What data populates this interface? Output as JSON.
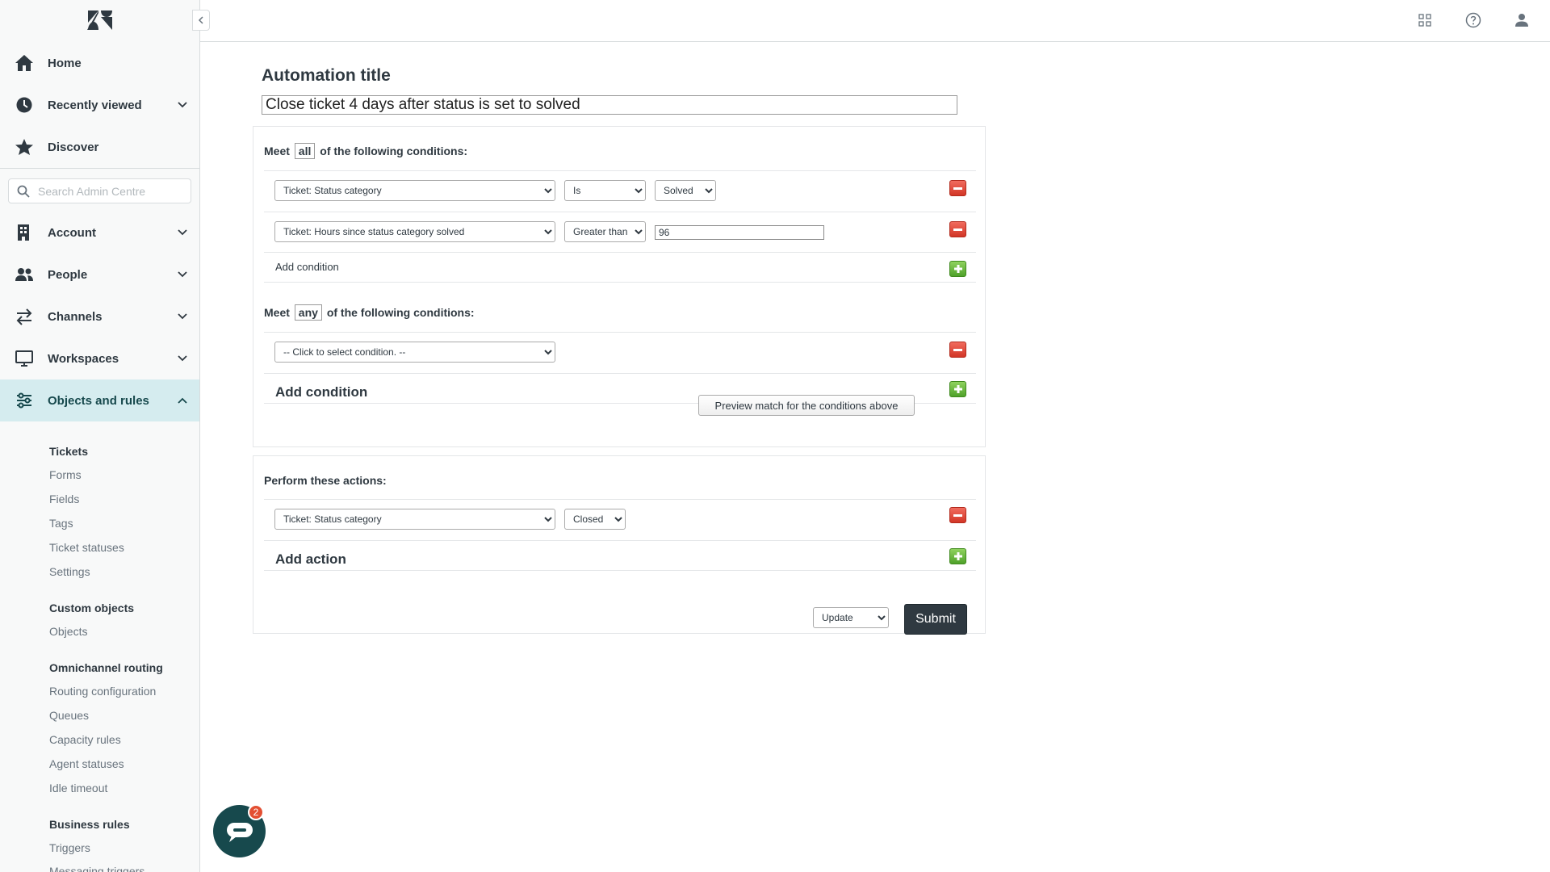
{
  "sidebar": {
    "nav_top": [
      {
        "label": "Home"
      },
      {
        "label": "Recently viewed"
      },
      {
        "label": "Discover"
      }
    ],
    "search_placeholder": "Search Admin Centre",
    "nav_main": [
      {
        "label": "Account"
      },
      {
        "label": "People"
      },
      {
        "label": "Channels"
      },
      {
        "label": "Workspaces"
      },
      {
        "label": "Objects and rules"
      }
    ],
    "sections": [
      {
        "heading": "Tickets",
        "links": [
          "Forms",
          "Fields",
          "Tags",
          "Ticket statuses",
          "Settings"
        ]
      },
      {
        "heading": "Custom objects",
        "links": [
          "Objects"
        ]
      },
      {
        "heading": "Omnichannel routing",
        "links": [
          "Routing configuration",
          "Queues",
          "Capacity rules",
          "Agent statuses",
          "Idle timeout"
        ]
      },
      {
        "heading": "Business rules",
        "links": [
          "Triggers",
          "Messaging triggers"
        ]
      }
    ]
  },
  "main": {
    "title_label": "Automation title",
    "title_value": "Close ticket 4 days after status is set to solved",
    "all_conditions": {
      "prefix": "Meet",
      "keyword": "all",
      "suffix": "of the following conditions:",
      "rows": [
        {
          "field": "Ticket: Status category",
          "operator": "Is",
          "value": "Solved"
        },
        {
          "field": "Ticket: Hours since status category solved",
          "operator": "Greater than",
          "value": "96"
        }
      ],
      "add_label": "Add condition"
    },
    "any_conditions": {
      "prefix": "Meet",
      "keyword": "any",
      "suffix": "of the following conditions:",
      "rows": [
        {
          "field": "-- Click to select condition. --"
        }
      ],
      "add_label": "Add condition",
      "preview_label": "Preview match for the conditions above"
    },
    "actions": {
      "heading": "Perform these actions:",
      "rows": [
        {
          "field": "Ticket: Status category",
          "value": "Closed"
        }
      ],
      "add_label": "Add action"
    },
    "footer": {
      "update_label": "Update",
      "submit_label": "Submit"
    }
  },
  "chat": {
    "badge_count": "2"
  },
  "colors": {
    "accent": "#17494d",
    "active_nav": "#d5ecef",
    "remove": "#d23526",
    "add": "#4fa12a",
    "submit": "#2f3941"
  }
}
